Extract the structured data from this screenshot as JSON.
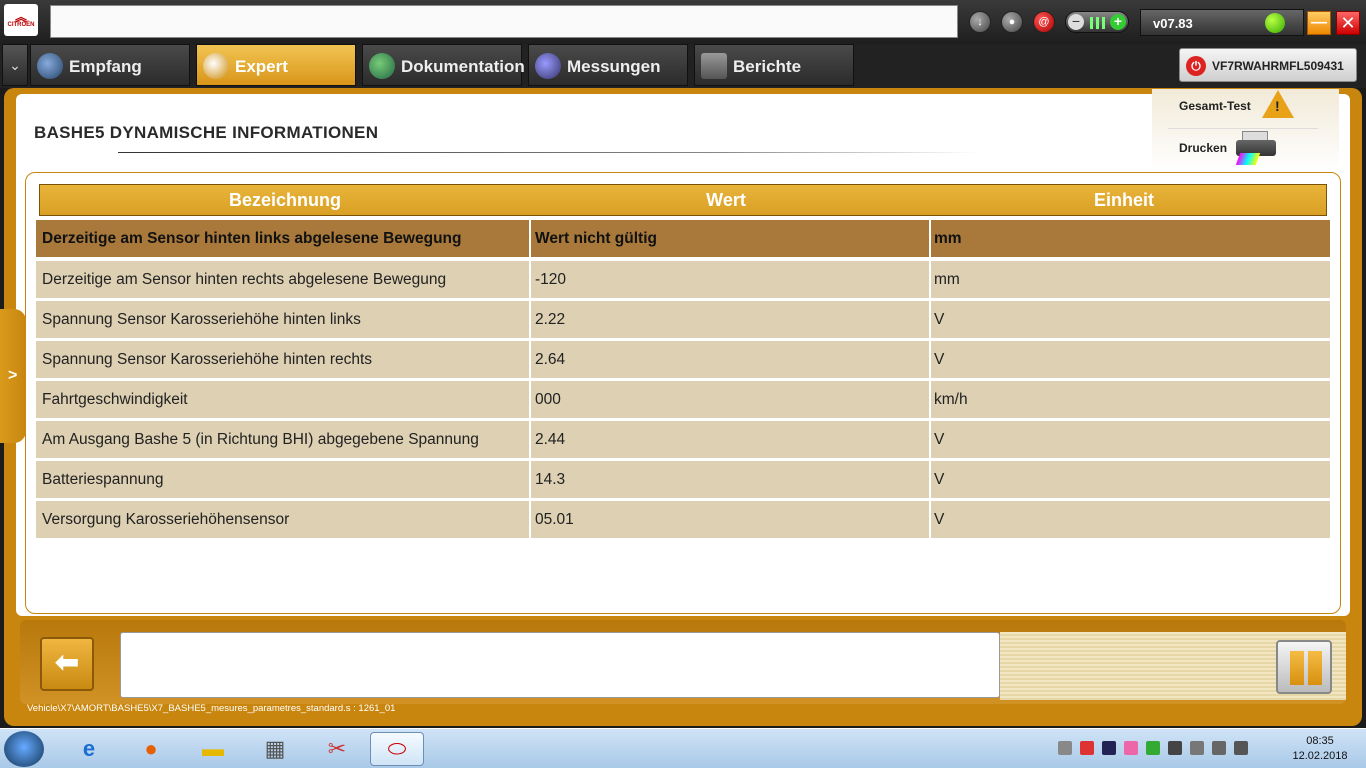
{
  "app": {
    "version": "v07.83",
    "vin": "VF7RWAHRMFL509431"
  },
  "tabs": [
    {
      "label": "Empfang",
      "active": false
    },
    {
      "label": "Expert",
      "active": true
    },
    {
      "label": "Dokumentation",
      "active": false
    },
    {
      "label": "Messungen",
      "active": false
    },
    {
      "label": "Berichte",
      "active": false
    }
  ],
  "side_panel": {
    "gesamt_test_label": "Gesamt-Test",
    "drucken_label": "Drucken"
  },
  "page": {
    "title": "BASHE5  DYNAMISCHE INFORMATIONEN"
  },
  "table": {
    "headers": [
      "Bezeichnung",
      "Wert",
      "Einheit"
    ],
    "rows": [
      {
        "name": "Derzeitige am Sensor hinten links abgelesene Bewegung",
        "value": "Wert nicht gültig",
        "unit": "mm",
        "selected": true
      },
      {
        "name": "Derzeitige am Sensor hinten rechts abgelesene Bewegung",
        "value": "-120",
        "unit": "mm"
      },
      {
        "name": "Spannung Sensor Karosseriehöhe hinten links",
        "value": "2.22",
        "unit": "V"
      },
      {
        "name": "Spannung Sensor Karosseriehöhe hinten rechts",
        "value": "2.64",
        "unit": "V"
      },
      {
        "name": "Fahrtgeschwindigkeit",
        "value": "000",
        "unit": "km/h"
      },
      {
        "name": "Am Ausgang Bashe 5 (in Richtung BHI) abgegebene Spannung",
        "value": "2.44",
        "unit": "V"
      },
      {
        "name": "Batteriespannung",
        "value": "14.3",
        "unit": "V"
      },
      {
        "name": "Versorgung Karosseriehöhensensor",
        "value": "05.01",
        "unit": "V"
      }
    ]
  },
  "status": {
    "path": "Vehicle\\X7\\AMORT\\BASHE5\\X7_BASHE5_mesures_parametres_standard.s : 1261_01"
  },
  "taskbar": {
    "time": "08:35",
    "date": "12.02.2018"
  },
  "colors": {
    "accent": "#c8860f",
    "header_bg": "#e0a830",
    "row_bg": "#ddd0b3",
    "selected_row_bg": "#a8793a"
  }
}
